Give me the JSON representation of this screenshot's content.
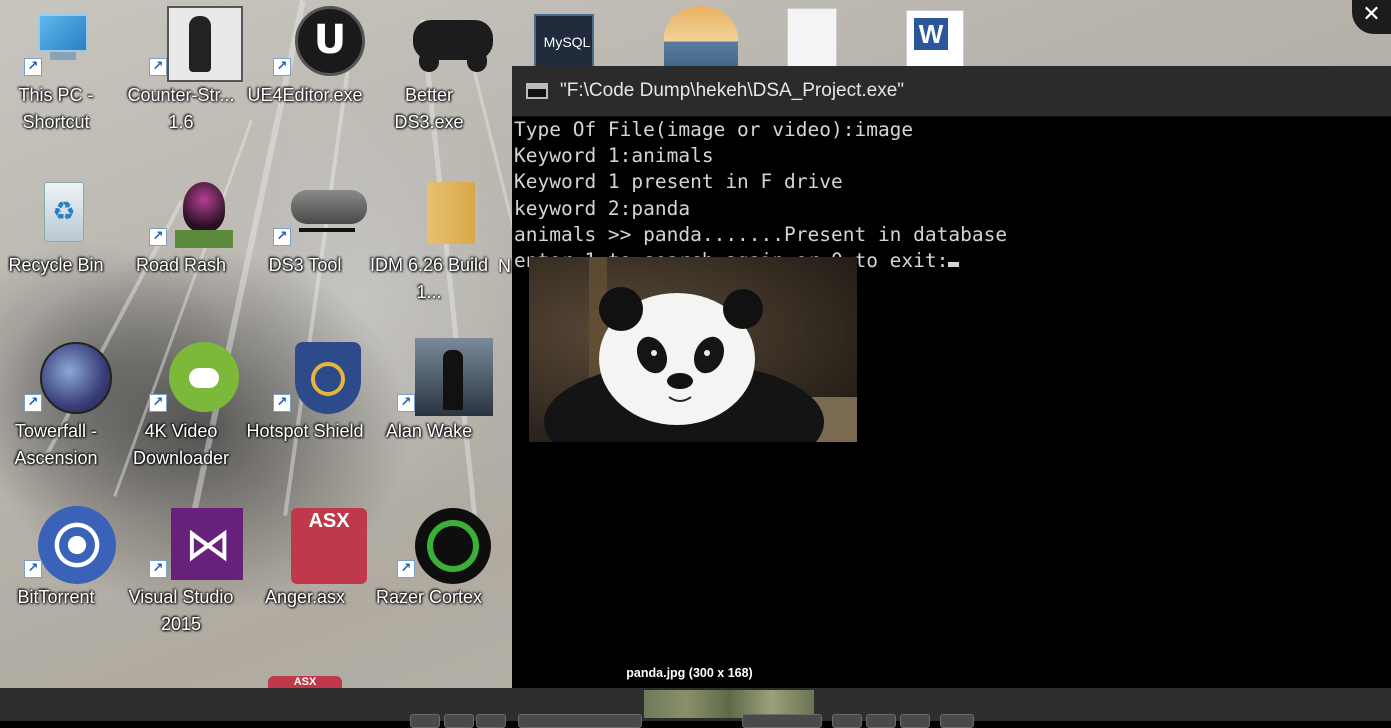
{
  "desktop": {
    "icons": [
      {
        "label": "This PC - Shortcut",
        "icon": "monitor-icon"
      },
      {
        "label": "Counter-Str... 1.6",
        "icon": "counter-strike-icon"
      },
      {
        "label": "UE4Editor.exe",
        "icon": "unreal-icon"
      },
      {
        "label": "Better DS3.exe",
        "icon": "gamepad-icon"
      },
      {
        "label": "Recycle Bin",
        "icon": "recycle-bin-icon"
      },
      {
        "label": "Road Rash",
        "icon": "helmet-icon"
      },
      {
        "label": "DS3 Tool",
        "icon": "controller-icon"
      },
      {
        "label": "IDM 6.26 Build 1...",
        "icon": "folder-icon"
      },
      {
        "label": "Towerfall - Ascension",
        "icon": "towerfall-icon"
      },
      {
        "label": "4K Video Downloader",
        "icon": "cloud-video-icon"
      },
      {
        "label": "Hotspot Shield",
        "icon": "shield-icon"
      },
      {
        "label": "Alan Wake",
        "icon": "alan-wake-icon"
      },
      {
        "label": "BitTorrent",
        "icon": "bittorrent-icon"
      },
      {
        "label": "Visual Studio 2015",
        "icon": "visual-studio-icon"
      },
      {
        "label": "Anger.asx",
        "icon": "asx-icon"
      },
      {
        "label": "Razer Cortex",
        "icon": "razer-cortex-icon"
      }
    ],
    "top_icons": [
      {
        "label": "MySQL",
        "icon": "mysql-icon"
      },
      {
        "label": "",
        "icon": "sunset-app-icon"
      },
      {
        "label": "",
        "icon": "blank-document-icon"
      },
      {
        "label": "W",
        "icon": "word-document-icon"
      }
    ],
    "partial_label": "N",
    "bottom_partial_label": "ASX"
  },
  "console": {
    "title": "\"F:\\Code Dump\\hekeh\\DSA_Project.exe\"",
    "lines": [
      "Type Of File(image or video):image",
      "Keyword 1:animals",
      "Keyword 1 present in F drive",
      "keyword 2:panda",
      "animals >> panda.......Present in database",
      "enter 1 to search again or 0 to exit:"
    ]
  },
  "viewer": {
    "caption": "panda.jpg (300 x 168)",
    "close_label": "✕"
  },
  "colors": {
    "console_bg": "#000000",
    "console_text": "#d4d4d4",
    "titlebar": "#2b2b2b",
    "toolbar": "#2e2e2e"
  }
}
